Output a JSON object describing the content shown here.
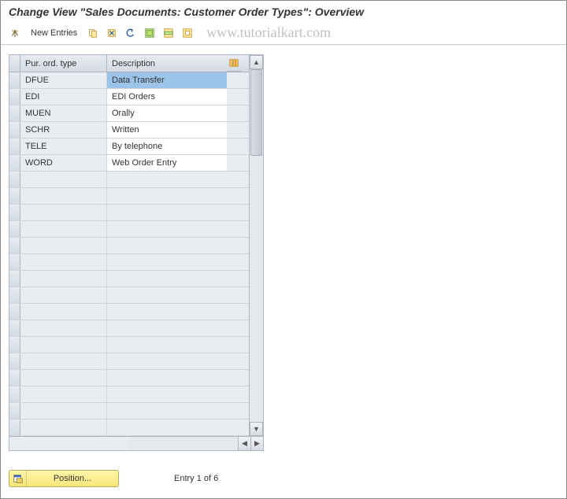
{
  "title": "Change View \"Sales Documents: Customer Order Types\": Overview",
  "toolbar": {
    "new_entries": "New Entries"
  },
  "watermark": "www.tutorialkart.com",
  "table": {
    "header": {
      "type": "Pur. ord. type",
      "desc": "Description"
    },
    "rows": [
      {
        "type": "DFUE",
        "desc": "Data Transfer",
        "selected": true
      },
      {
        "type": "EDI",
        "desc": "EDI Orders",
        "selected": false
      },
      {
        "type": "MUEN",
        "desc": "Orally",
        "selected": false
      },
      {
        "type": "SCHR",
        "desc": "Written",
        "selected": false
      },
      {
        "type": "TELE",
        "desc": "By telephone",
        "selected": false
      },
      {
        "type": "WORD",
        "desc": "Web Order Entry",
        "selected": false
      }
    ],
    "empty_rows": 16
  },
  "footer": {
    "position": "Position...",
    "entry": "Entry 1 of 6"
  }
}
